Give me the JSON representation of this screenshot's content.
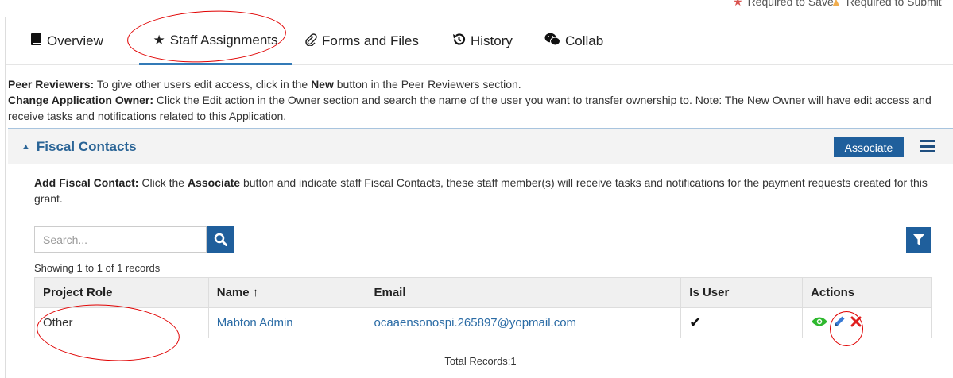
{
  "header": {
    "required_save": "Required to Save",
    "required_submit": "Required to Submit"
  },
  "tabs": [
    {
      "label": "Overview",
      "icon": "book-icon"
    },
    {
      "label": "Staff Assignments",
      "icon": "star-icon",
      "active": true
    },
    {
      "label": "Forms and Files",
      "icon": "paperclip-icon"
    },
    {
      "label": "History",
      "icon": "history-icon"
    },
    {
      "label": "Collab",
      "icon": "wechat-icon"
    }
  ],
  "info": {
    "peer_label": "Peer Reviewers:",
    "peer_text_1": " To give other users edit access, click in the ",
    "peer_new": "New",
    "peer_text_2": " button in the Peer Reviewers section.",
    "owner_label": "Change Application Owner:",
    "owner_text": " Click the Edit action in the Owner section and search the name of the user you want to transfer ownership to. Note: The New Owner will have edit access and receive tasks and notifications related to this Application."
  },
  "panel": {
    "title": "Fiscal Contacts",
    "associate_label": "Associate",
    "desc_label": "Add Fiscal Contact:",
    "desc_text_1": " Click the ",
    "desc_assoc": "Associate",
    "desc_text_2": " button and indicate staff Fiscal Contacts, these staff member(s) will receive tasks and notifications for the payment requests created for this grant."
  },
  "search": {
    "placeholder": "Search..."
  },
  "records": {
    "showing": "Showing 1 to 1 of 1 records",
    "total": "Total Records:1"
  },
  "table": {
    "headers": [
      "Project Role",
      "Name ↑",
      "Email",
      "Is User",
      "Actions"
    ],
    "rows": [
      {
        "role": "Other",
        "name": "Mabton Admin",
        "email": "ocaaensonospi.265897@yopmail.com",
        "is_user": "✔"
      }
    ]
  },
  "colors": {
    "accent": "#1f5f9c",
    "link": "#2a6ba5",
    "annotation": "#e00000"
  }
}
